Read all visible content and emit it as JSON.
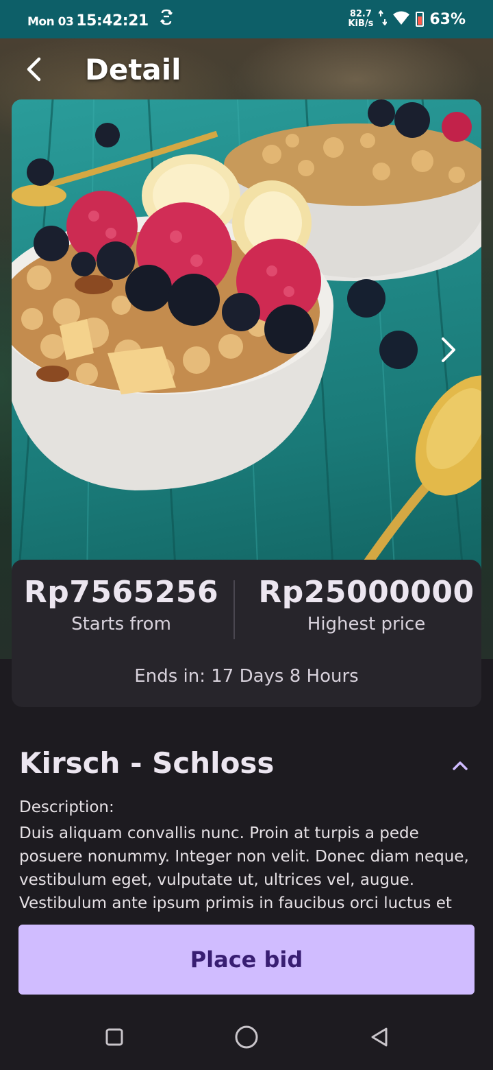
{
  "status_bar": {
    "day": "Mon 03",
    "time": "15:42:21",
    "speed_value": "82.7",
    "speed_unit": "KiB/s",
    "battery": "63%",
    "icons": [
      "sync-icon",
      "data-arrows-icon",
      "wifi-icon",
      "battery-icon"
    ]
  },
  "header": {
    "title": "Detail",
    "back_icon": "chevron-left-icon"
  },
  "hero": {
    "next_icon": "chevron-right-icon"
  },
  "price_card": {
    "start_price": "Rp7565256",
    "start_label": "Starts from",
    "highest_price": "Rp25000000",
    "highest_label": "Highest price",
    "ends_in": "Ends in: 17 Days 8 Hours"
  },
  "item": {
    "title": "Kirsch - Schloss",
    "collapse_icon": "chevron-up-icon",
    "description_label": "Description:",
    "description": "Duis aliquam convallis nunc. Proin at turpis a pede posuere nonummy. Integer non velit. Donec diam neque, vestibulum eget, vulputate ut, ultrices vel, augue. Vestibulum ante ipsum primis in faucibus orci luctus et"
  },
  "actions": {
    "place_bid_label": "Place bid"
  },
  "colors": {
    "status_bar_bg": "#0d5f68",
    "background": "#1d1b20",
    "card_bg": "#27252b",
    "accent": "#d0bcff",
    "accent_text": "#381e72"
  },
  "nav_bar": {
    "icons": [
      "recents-square-icon",
      "home-circle-icon",
      "back-triangle-icon"
    ]
  }
}
